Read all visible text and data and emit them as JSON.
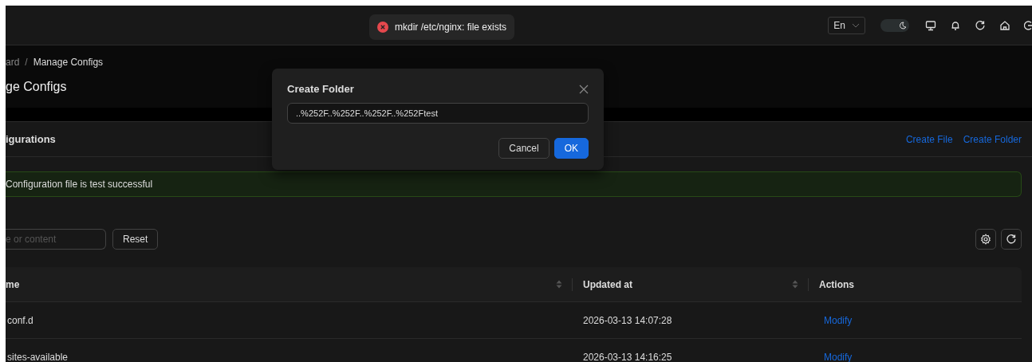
{
  "toast": {
    "kind": "error",
    "message": "mkdir /etc/nginx: file exists"
  },
  "header": {
    "language": "En",
    "dark_mode": true
  },
  "breadcrumb": {
    "separator": "/",
    "items": [
      "ard",
      "Manage Configs"
    ]
  },
  "page_title": "ge Configs",
  "card": {
    "title": "igurations",
    "actions": [
      "Create File",
      "Create Folder"
    ]
  },
  "alert": {
    "kind": "success",
    "message": "Configuration file is test successful"
  },
  "search": {
    "placeholder": "e or content"
  },
  "reset_button": "Reset",
  "table": {
    "columns": [
      {
        "label": "me",
        "sortable": true
      },
      {
        "label": "Updated at",
        "sortable": true
      },
      {
        "label": "Actions",
        "sortable": false
      }
    ],
    "rows": [
      {
        "name": "conf.d",
        "updated": "2026-03-13 14:07:28",
        "action": "Modify"
      },
      {
        "name": "sites-available",
        "updated": "2026-03-13 14:16:25",
        "action": "Modify"
      }
    ]
  },
  "dialog": {
    "title": "Create Folder",
    "value": "..%252F..%252F..%252F..%252Ftest",
    "buttons": [
      {
        "label": "Cancel",
        "kind": "default"
      },
      {
        "label": "OK",
        "kind": "primary"
      }
    ]
  }
}
